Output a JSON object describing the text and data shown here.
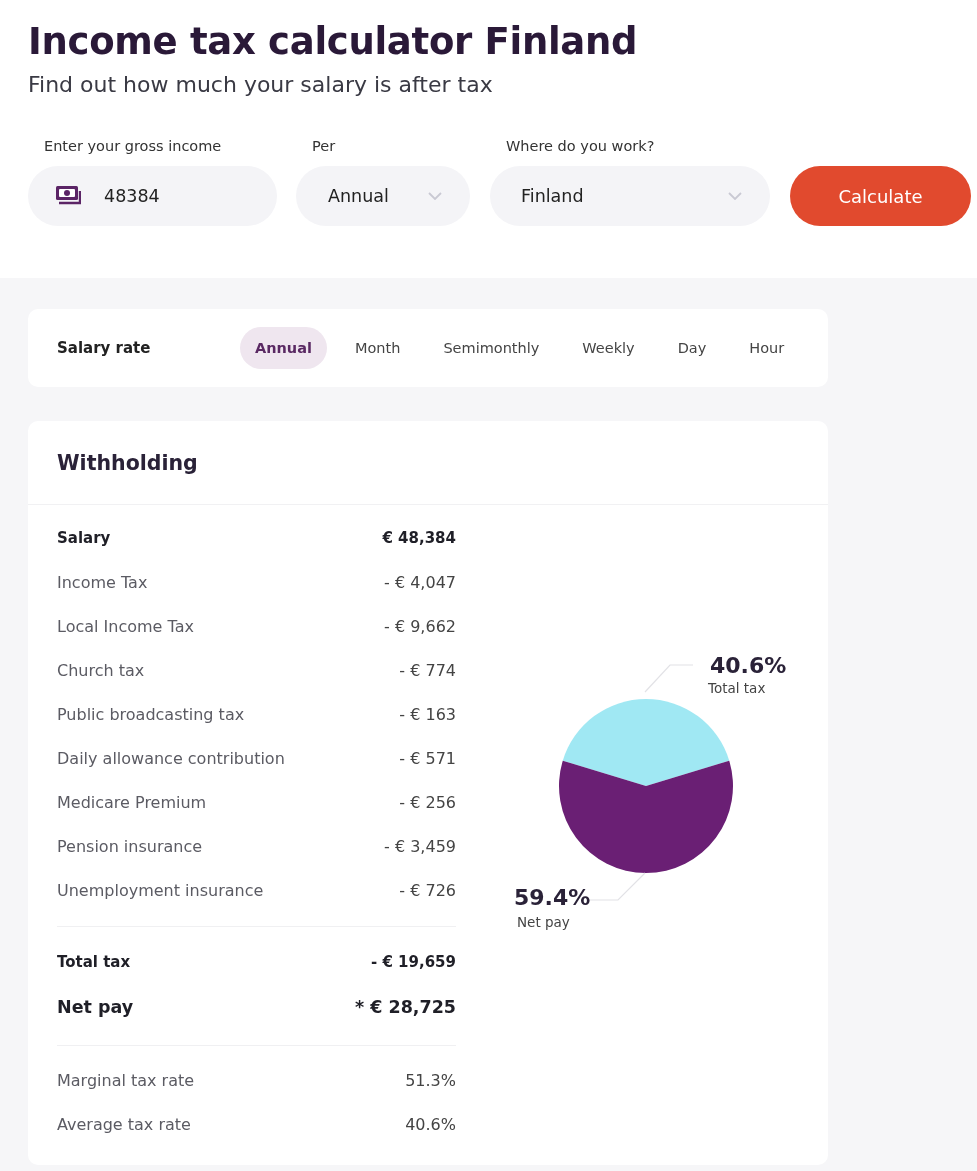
{
  "header": {
    "title": "Income tax calculator Finland",
    "subtitle": "Find out how much your salary is after tax"
  },
  "form": {
    "income": {
      "label": "Enter your gross income",
      "value": "48384"
    },
    "period": {
      "label": "Per",
      "value": "Annual"
    },
    "location": {
      "label": "Where do you work?",
      "value": "Finland"
    },
    "submit": "Calculate"
  },
  "salary_rate": {
    "title": "Salary rate",
    "tabs": [
      {
        "label": "Annual",
        "selected": true
      },
      {
        "label": "Month",
        "selected": false
      },
      {
        "label": "Semimonthly",
        "selected": false
      },
      {
        "label": "Weekly",
        "selected": false
      },
      {
        "label": "Day",
        "selected": false
      },
      {
        "label": "Hour",
        "selected": false
      }
    ]
  },
  "withholding": {
    "title": "Withholding",
    "rows": [
      {
        "kind": "main",
        "label": "Salary",
        "value": "€ 48,384"
      },
      {
        "kind": "deduction",
        "label": "Income Tax",
        "value": "- € 4,047"
      },
      {
        "kind": "deduction",
        "label": "Local Income Tax",
        "value": "- € 9,662"
      },
      {
        "kind": "deduction",
        "label": "Church tax",
        "value": "- € 774"
      },
      {
        "kind": "deduction",
        "label": "Public broadcasting tax",
        "value": "- € 163"
      },
      {
        "kind": "deduction",
        "label": "Daily allowance contribution",
        "value": "- € 571"
      },
      {
        "kind": "deduction",
        "label": "Medicare Premium",
        "value": "- € 256"
      },
      {
        "kind": "deduction",
        "label": "Pension insurance",
        "value": "- € 3,459"
      },
      {
        "kind": "deduction",
        "label": "Unemployment insurance",
        "value": "- € 726"
      }
    ],
    "totals": [
      {
        "kind": "total",
        "label": "Total tax",
        "value": "- € 19,659"
      },
      {
        "kind": "net",
        "label": "Net pay",
        "value": "* € 28,725"
      }
    ],
    "rates": [
      {
        "label": "Marginal tax rate",
        "value": "51.3%"
      },
      {
        "label": "Average tax rate",
        "value": "40.6%"
      }
    ],
    "chart": {
      "chart_data": {
        "type": "pie",
        "categories": [
          "Total tax",
          "Net pay"
        ],
        "series": [
          {
            "values": [
              40.6,
              59.4
            ]
          }
        ],
        "value_labels": [
          "40.6%",
          "59.4%"
        ]
      },
      "slices": [
        {
          "color": "#a0e8f3"
        },
        {
          "color": "#6a1f74"
        }
      ]
    }
  }
}
